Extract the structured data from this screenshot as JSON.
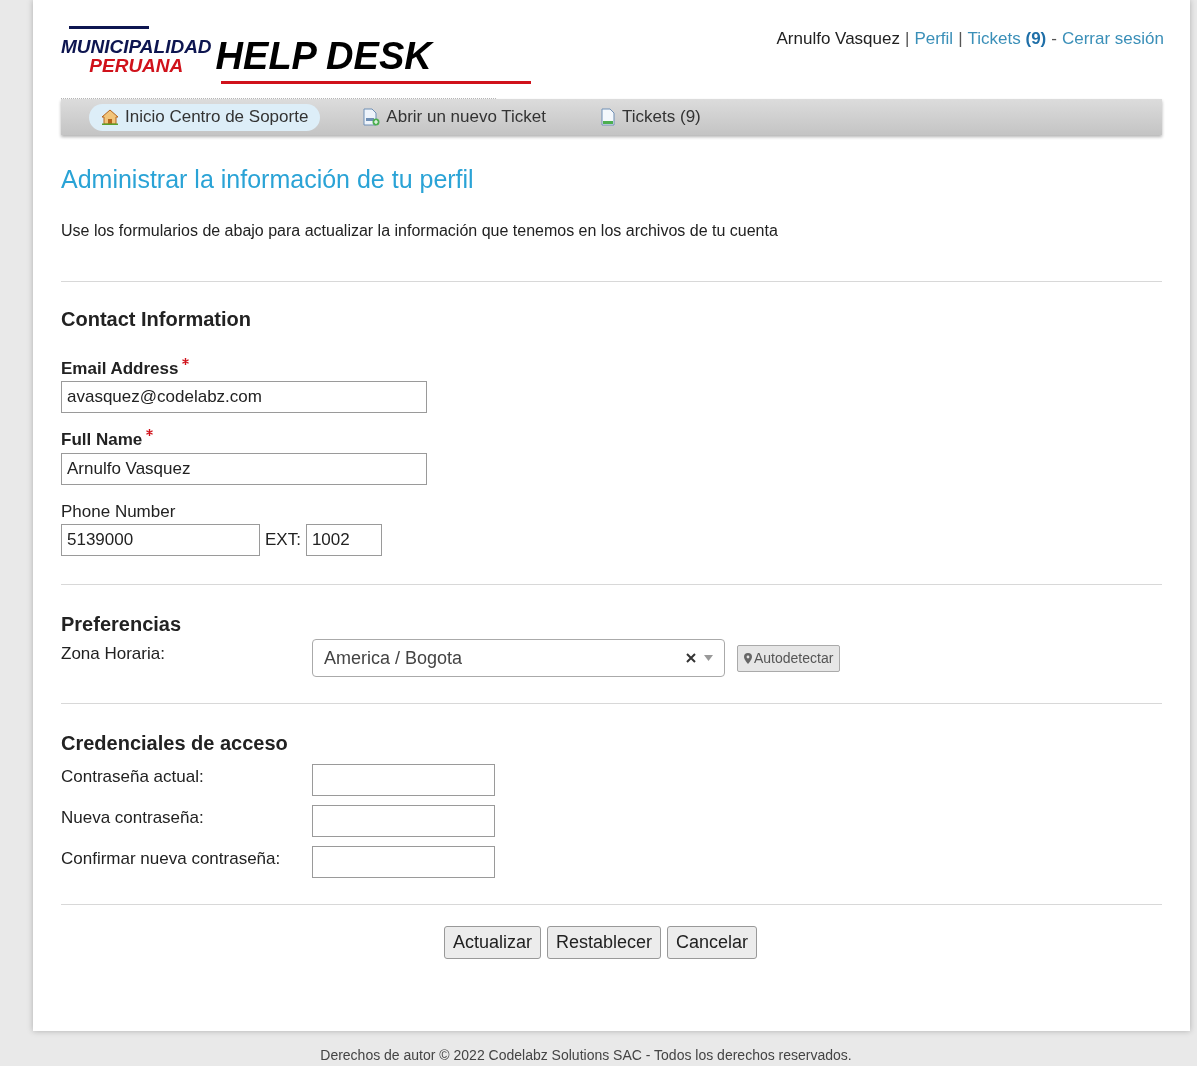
{
  "logo": {
    "line1": "MUNICIPALIDAD",
    "line2": "PERUANA",
    "title": "HELP DESK"
  },
  "user_menu": [
    {
      "kind": "text",
      "text": "Arnulfo Vasquez"
    },
    {
      "kind": "sep",
      "text": "|"
    },
    {
      "kind": "link",
      "text": "Perfil"
    },
    {
      "kind": "sep",
      "text": "|"
    },
    {
      "kind": "link",
      "text": "Tickets",
      "count": "(9)"
    },
    {
      "kind": "sep",
      "text": "-"
    },
    {
      "kind": "link",
      "text": "Cerrar sesión"
    }
  ],
  "nav": [
    {
      "kind": "home",
      "label": "Inicio Centro de Soporte",
      "selected": true
    },
    {
      "kind": "new",
      "label": "Abrir un nuevo Ticket",
      "selected": false
    },
    {
      "kind": "tickets",
      "label": "Tickets (9)",
      "selected": false
    }
  ],
  "page_title": "Administrar la información de tu perfil",
  "intro": "Use los formularios de abajo para actualizar la información que tenemos en los archivos de tu cuenta",
  "contact": {
    "heading": "Contact Information",
    "fields": [
      {
        "label": "Email Address",
        "required": true,
        "value": "avasquez@codelabz.com"
      },
      {
        "label": "Full Name",
        "required": true,
        "value": "Arnulfo Vasquez"
      }
    ],
    "phone": {
      "label": "Phone Number",
      "value": "5139000",
      "ext_label": "EXT:",
      "ext_value": "1002"
    }
  },
  "preferences": {
    "heading": "Preferencias",
    "label": "Zona Horaria:",
    "value": "America / Bogota",
    "button": "Autodetectar"
  },
  "credentials": {
    "heading": "Credenciales de acceso",
    "fields": [
      {
        "label": "Contraseña actual:"
      },
      {
        "label": "Nueva contraseña:"
      },
      {
        "label": "Confirmar nueva contraseña:"
      }
    ]
  },
  "buttons": [
    "Actualizar",
    "Restablecer",
    "Cancelar"
  ],
  "footer": "Derechos de autor © 2022 Codelabz Solutions SAC - Todos los derechos reservados."
}
